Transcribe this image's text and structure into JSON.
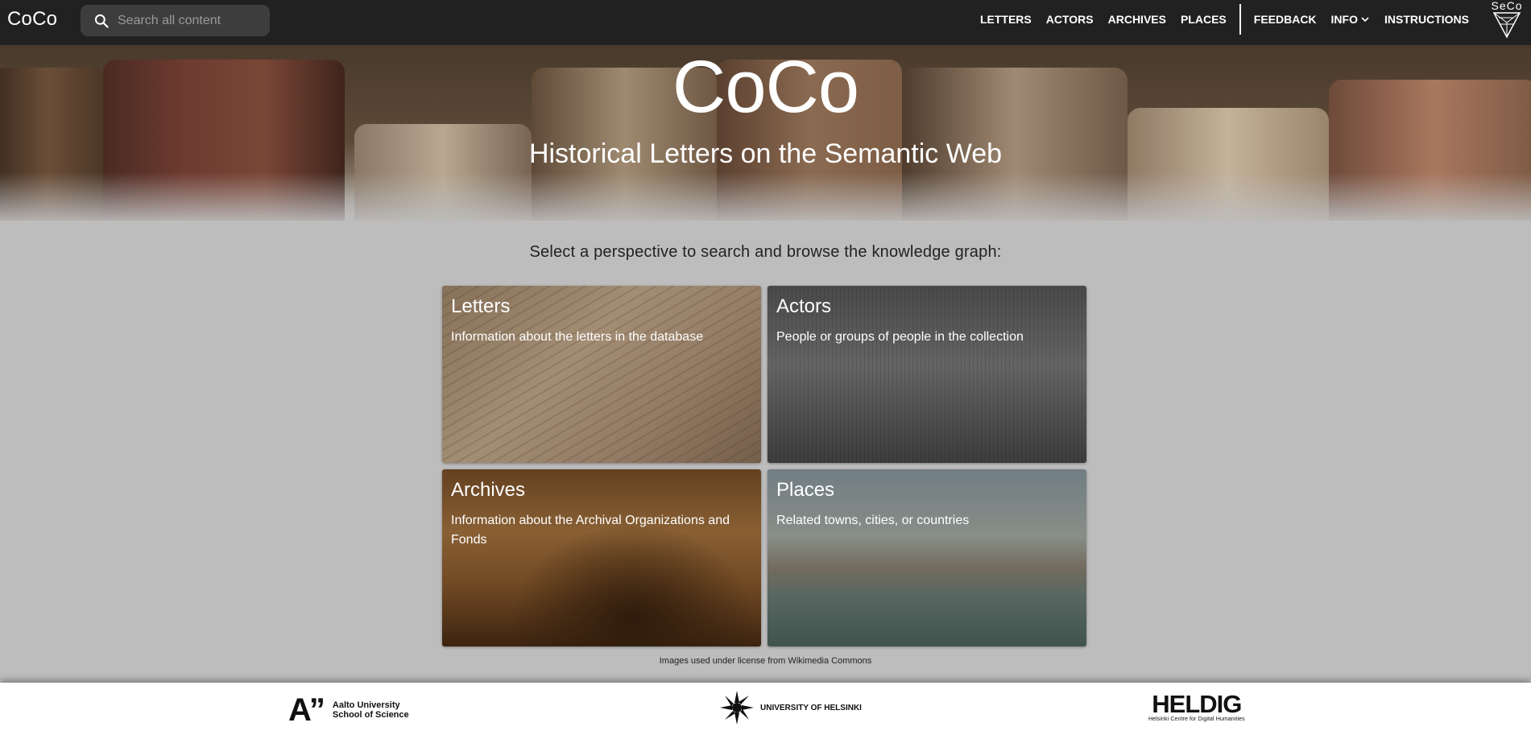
{
  "app": {
    "brand": "CoCo",
    "search": {
      "placeholder": "Search all content"
    }
  },
  "nav": {
    "items": [
      "LETTERS",
      "ACTORS",
      "ARCHIVES",
      "PLACES"
    ],
    "secondary": [
      "FEEDBACK",
      "INFO",
      "INSTRUCTIONS"
    ],
    "logo_text": "SeCo"
  },
  "hero": {
    "title": "CoCo",
    "subtitle": "Historical Letters on the Semantic Web"
  },
  "main": {
    "prompt": "Select a perspective to search and browse the knowledge graph:",
    "cards": [
      {
        "title": "Letters",
        "description": "Information about the letters in the database"
      },
      {
        "title": "Actors",
        "description": "People or groups of people in the collection"
      },
      {
        "title": "Archives",
        "description": "Information about the Archival Organizations and Fonds"
      },
      {
        "title": "Places",
        "description": "Related towns, cities, or countries"
      }
    ],
    "credit": "Images used under license from Wikimedia Commons"
  },
  "footer": {
    "aalto": {
      "mark": "A”",
      "line1": "Aalto University",
      "line2": "School of Science"
    },
    "helsinki": {
      "name": "UNIVERSITY OF HELSINKI"
    },
    "heldig": {
      "name": "HELDIG",
      "tagline": "Helsinki Centre for Digital Humanities"
    }
  },
  "colors": {
    "topbar": "#212121",
    "search_bg": "#3d3d3d",
    "page_bg": "#bdbdbd",
    "footer_bg": "#ffffff",
    "text_light": "#ffffff"
  }
}
